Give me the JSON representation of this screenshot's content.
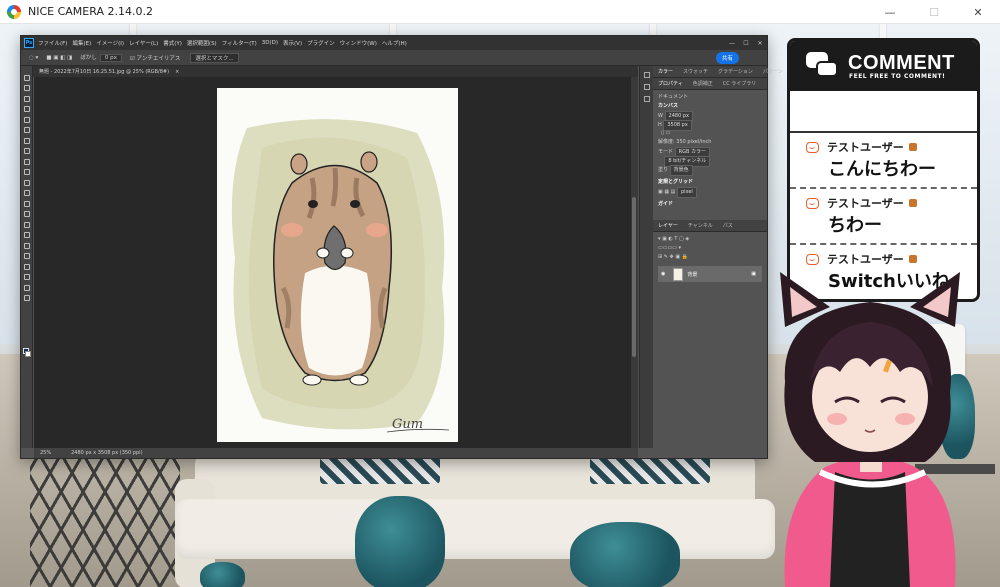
{
  "titlebar": {
    "app_title": "NICE CAMERA 2.14.0.2",
    "minimize": "—",
    "maximize": "☐",
    "close": "✕"
  },
  "photoshop": {
    "menus": [
      "ファイル(F)",
      "編集(E)",
      "イメージ(I)",
      "レイヤー(L)",
      "書式(Y)",
      "選択範囲(S)",
      "フィルター(T)",
      "3D(D)",
      "表示(V)",
      "プラグイン",
      "ウィンドウ(W)",
      "ヘルプ(H)"
    ],
    "options": {
      "blur_label": "ぼかし",
      "blur_value": "0 px",
      "antialias": "アンチエイリアス",
      "select_mask": "選択とマスク..."
    },
    "share_label": "共有",
    "doc_tab": "無題 - 2022年7月10日 16.25.51.jpg @ 25% (RGB/8#)",
    "status": {
      "zoom": "25%",
      "size": "2480 px x 3508 px (350 ppi)"
    },
    "panel_tabs_top": [
      "カラー",
      "スウォッチ",
      "グラデーション",
      "パターン"
    ],
    "properties_tabs": [
      "プロパティ",
      "色調補正",
      "CC ライブラリ"
    ],
    "properties": {
      "document": "ドキュメント",
      "canvas_head": "カンバス",
      "width": "2480 px",
      "height": "3508 px",
      "resolution": "解像度: 350 pixel/inch",
      "mode_label": "モード",
      "mode_value": "RGB カラー",
      "bits_value": "8 bit/チャンネル",
      "fill_label": "塗り",
      "fill_value": "背景色",
      "rulers_head": "定規とグリッド",
      "ruler_unit": "pixel",
      "guides_head": "ガイド"
    },
    "layers_tabs": [
      "レイヤー",
      "チャンネル",
      "パス"
    ],
    "layer_name": "背景"
  },
  "comment_widget": {
    "title": "COMMENT",
    "subtitle": "FEEL FREE TO COMMENT!",
    "comments": [
      {
        "user": "テストユーザー",
        "text": "こんにちわー"
      },
      {
        "user": "テストユーザー",
        "text": "ちわー"
      },
      {
        "user": "テストユーザー",
        "text": "Switchいいね"
      }
    ]
  },
  "artwork": {
    "signature": "Gum"
  }
}
